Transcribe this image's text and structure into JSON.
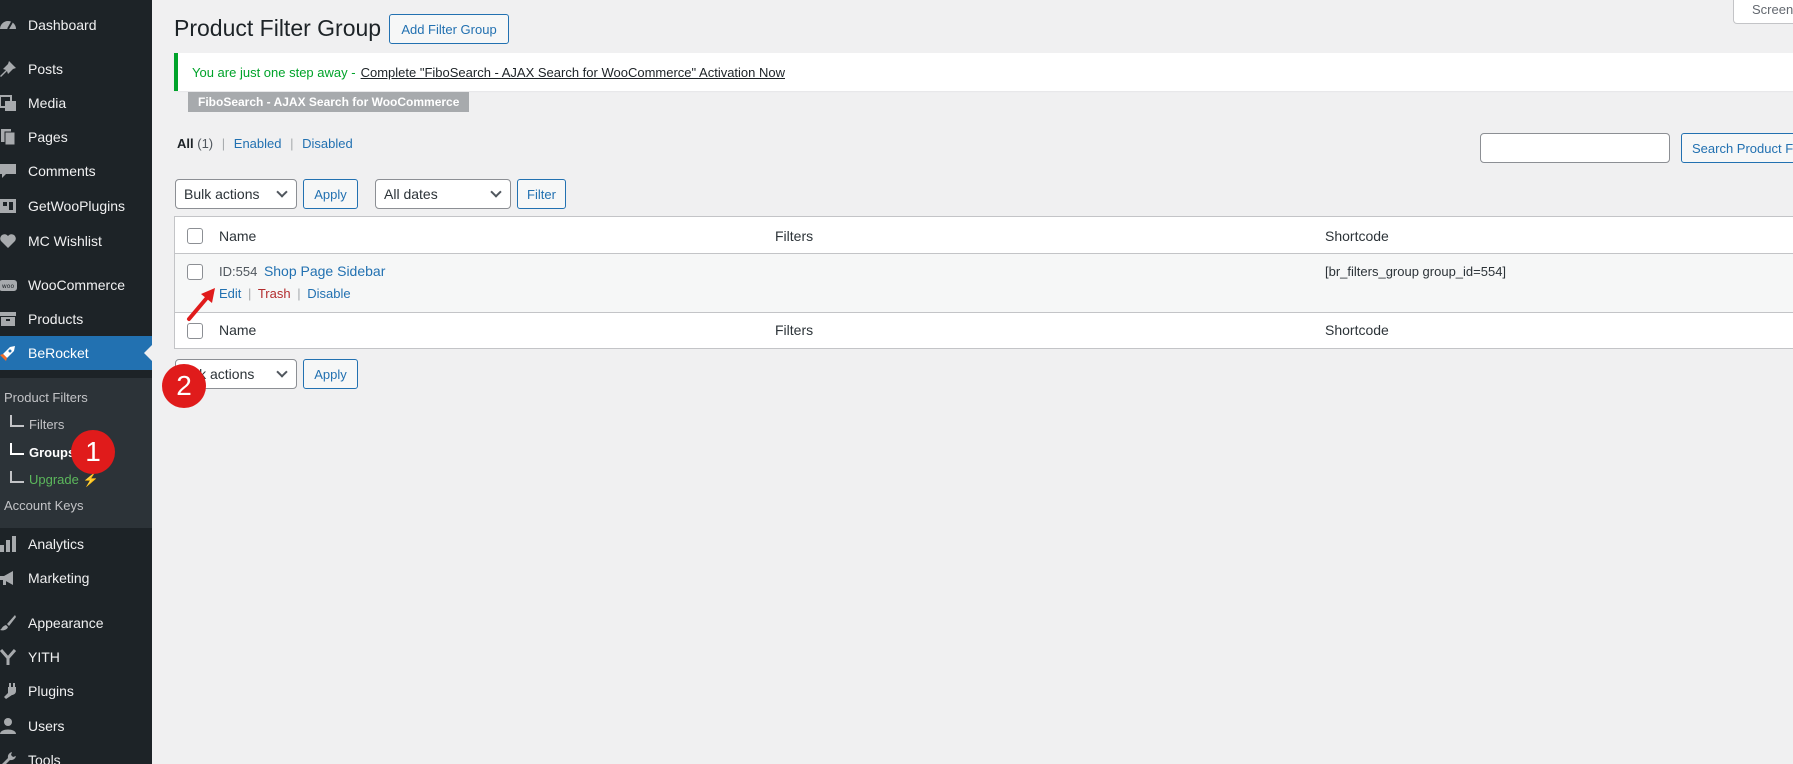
{
  "sidebar": {
    "items": [
      {
        "label": "Dashboard",
        "icon": "dashboard-icon"
      },
      {
        "label": "Posts",
        "icon": "pin-icon"
      },
      {
        "label": "Media",
        "icon": "media-icon"
      },
      {
        "label": "Pages",
        "icon": "pages-icon"
      },
      {
        "label": "Comments",
        "icon": "comments-icon"
      },
      {
        "label": "GetWooPlugins",
        "icon": "getwooplugins-icon"
      },
      {
        "label": "MC Wishlist",
        "icon": "heart-icon"
      },
      {
        "label": "WooCommerce",
        "icon": "woocommerce-icon"
      },
      {
        "label": "Products",
        "icon": "archive-icon"
      },
      {
        "label": "BeRocket",
        "icon": "rocket-icon"
      },
      {
        "label": "Analytics",
        "icon": "analytics-icon"
      },
      {
        "label": "Marketing",
        "icon": "megaphone-icon"
      },
      {
        "label": "Appearance",
        "icon": "brush-icon"
      },
      {
        "label": "YITH",
        "icon": "yith-icon"
      },
      {
        "label": "Plugins",
        "icon": "plugin-icon"
      },
      {
        "label": "Users",
        "icon": "users-icon"
      },
      {
        "label": "Tools",
        "icon": "tools-icon"
      }
    ],
    "submenu": {
      "product_filters": "Product Filters",
      "filters": "Filters",
      "groups": "Groups",
      "upgrade": "Upgrade ⚡",
      "account_keys": "Account Keys"
    }
  },
  "header": {
    "title": "Product Filter Group",
    "add_button": "Add Filter Group",
    "screen_options": "Screen"
  },
  "notice": {
    "text": "You are just one step away -",
    "link": "Complete \"FiboSearch - AJAX Search for WooCommerce\" Activation Now",
    "tag": "FiboSearch - AJAX Search for WooCommerce"
  },
  "views": {
    "all": "All",
    "all_count": "(1)",
    "enabled": "Enabled",
    "disabled": "Disabled",
    "sep": "|"
  },
  "search": {
    "button": "Search Product Fi",
    "placeholder": ""
  },
  "toolbar": {
    "bulk_actions": "Bulk actions",
    "apply": "Apply",
    "dates": "All dates",
    "filter": "Filter"
  },
  "table": {
    "columns": [
      "Name",
      "Filters",
      "Shortcode"
    ],
    "rows": [
      {
        "id": "ID:554",
        "name": "Shop Page Sidebar",
        "shortcode": "[br_filters_group group_id=554]",
        "actions": {
          "edit": "Edit",
          "trash": "Trash",
          "disable": "Disable"
        }
      }
    ]
  },
  "footer_toolbar": {
    "bulk_actions": "lk actions",
    "apply": "Apply"
  },
  "annotations": {
    "badge1": "1",
    "badge2": "2",
    "color": "#e01b1b"
  },
  "colors": {
    "sidebar_bg": "#1d2327",
    "accent": "#2271b1",
    "notice_green": "#00a32a",
    "trash_red": "#b32d2e"
  }
}
